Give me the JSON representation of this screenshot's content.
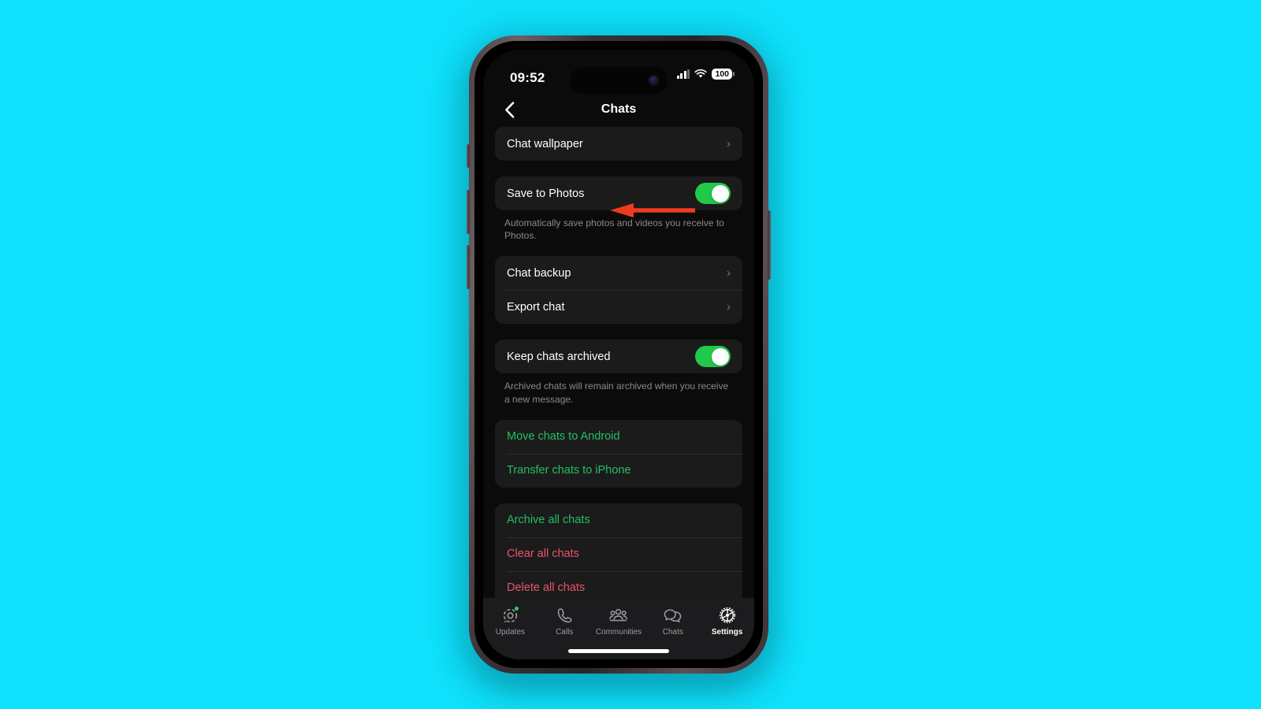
{
  "background": {
    "color": "#0FE0FB"
  },
  "status_bar": {
    "time": "09:52",
    "battery_level": "100",
    "signal_icon": "cellular-signal-icon",
    "wifi_icon": "wifi-icon"
  },
  "nav": {
    "back_icon": "chevron-left-icon",
    "title": "Chats"
  },
  "groups": [
    {
      "id": "wallpaper-group",
      "rows": [
        {
          "label": "Chat wallpaper",
          "type": "disclosure",
          "style": "default"
        }
      ]
    },
    {
      "id": "save-photos-group",
      "rows": [
        {
          "label": "Save to Photos",
          "type": "toggle",
          "style": "default",
          "toggle_on": true
        }
      ],
      "footnote": "Automatically save photos and videos you receive to Photos."
    },
    {
      "id": "backup-group",
      "rows": [
        {
          "label": "Chat backup",
          "type": "disclosure",
          "style": "default"
        },
        {
          "label": "Export chat",
          "type": "disclosure",
          "style": "default"
        }
      ]
    },
    {
      "id": "archive-group",
      "rows": [
        {
          "label": "Keep chats archived",
          "type": "toggle",
          "style": "default",
          "toggle_on": true
        }
      ],
      "footnote": "Archived chats will remain archived when you receive a new message."
    },
    {
      "id": "transfer-group",
      "rows": [
        {
          "label": "Move chats to Android",
          "type": "action",
          "style": "green"
        },
        {
          "label": "Transfer chats to iPhone",
          "type": "action",
          "style": "green"
        }
      ]
    },
    {
      "id": "bulk-actions-group",
      "rows": [
        {
          "label": "Archive all chats",
          "type": "action",
          "style": "green"
        },
        {
          "label": "Clear all chats",
          "type": "action",
          "style": "red"
        },
        {
          "label": "Delete all chats",
          "type": "action",
          "style": "red"
        }
      ]
    }
  ],
  "tab_bar": {
    "items": [
      {
        "label": "Updates",
        "icon": "updates-status-icon",
        "active": false,
        "badge": true
      },
      {
        "label": "Calls",
        "icon": "phone-icon",
        "active": false,
        "badge": false
      },
      {
        "label": "Communities",
        "icon": "communities-people-icon",
        "active": false,
        "badge": false
      },
      {
        "label": "Chats",
        "icon": "chat-bubbles-icon",
        "active": false,
        "badge": false
      },
      {
        "label": "Settings",
        "icon": "gear-icon",
        "active": true,
        "badge": false
      }
    ]
  },
  "annotation": {
    "type": "arrow-pointing-left",
    "color": "#EE3B1E",
    "target": "Save to Photos toggle"
  },
  "colors": {
    "accent_green": "#21C063",
    "toggle_green": "#21C94A",
    "destructive_red": "#E8556B",
    "card_background": "#1B1B1B",
    "screen_background": "#0B0B0B",
    "annotation_red": "#EE3B1E"
  }
}
